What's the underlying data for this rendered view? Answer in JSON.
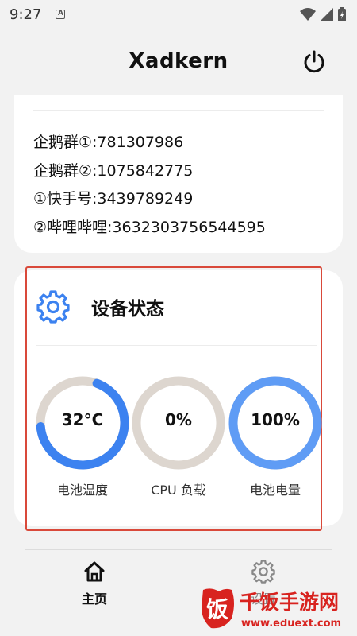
{
  "status_bar": {
    "time": "9:27",
    "notif_letter": "A"
  },
  "app": {
    "title": "Xadkern",
    "power_icon": "power-icon"
  },
  "info": {
    "lines": [
      "企鹅群①:781307986",
      "企鹅群②:1075842775",
      "①快手号:3439789249",
      "②哔哩哔哩:3632303756544595"
    ]
  },
  "device_status": {
    "title": "设备状态",
    "gauges": [
      {
        "value": "32°C",
        "label": "电池温度",
        "fraction": 0.68,
        "color": "#3c82f0"
      },
      {
        "value": "0%",
        "label": "CPU 负载",
        "fraction": 0.0,
        "color": "#3c82f0"
      },
      {
        "value": "100%",
        "label": "电池电量",
        "fraction": 1.0,
        "color": "#5f9cf5"
      }
    ],
    "track_color": "#ddd6cf"
  },
  "nav": {
    "home_label": "主页",
    "settings_label": "设置"
  },
  "watermark": {
    "text": "千饭手游网",
    "url": "www.eduext.com",
    "glyph": "饭"
  },
  "colors": {
    "accent": "#3c82f0",
    "highlight": "#d9493a",
    "brand_red": "#d8231f"
  }
}
